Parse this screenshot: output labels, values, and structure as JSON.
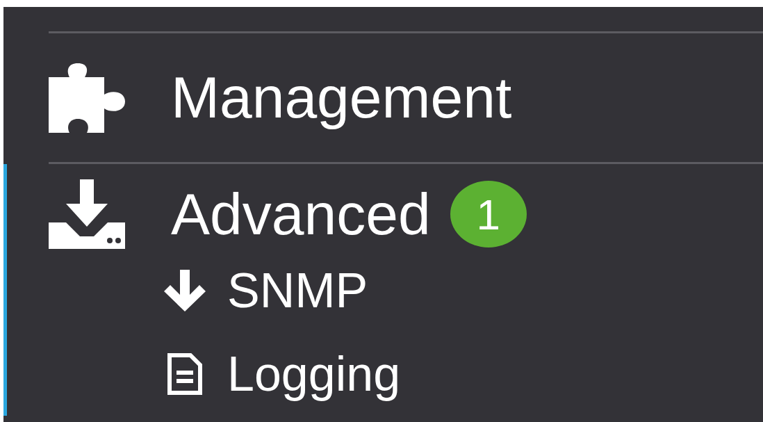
{
  "sidebar": {
    "items": [
      {
        "label": "Management",
        "selected": false
      },
      {
        "label": "Advanced",
        "selected": true,
        "badge": "1",
        "children": [
          {
            "label": "SNMP"
          },
          {
            "label": "Logging"
          }
        ]
      }
    ]
  }
}
